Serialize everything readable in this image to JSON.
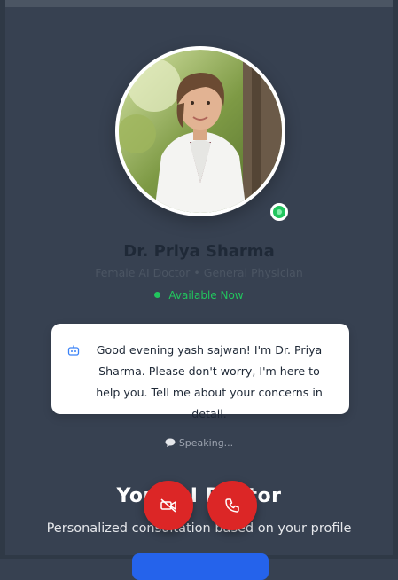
{
  "doctor": {
    "name": "Dr. Priya Sharma",
    "subtitle": "Female AI Doctor • General Physician",
    "status": "Available Now"
  },
  "message": {
    "text": "Good evening yash sajwan! I'm Dr. Priya Sharma. Please don't worry, I'm here to help you. Tell me about your concerns in detail."
  },
  "speaking_label": "Speaking...",
  "hero": {
    "title": "Your AI Doctor",
    "subtitle": "Personalized consultation based on your profile"
  },
  "colors": {
    "background": "#374151",
    "online": "#22c55e",
    "call_button": "#dc2626",
    "primary": "#2563eb"
  },
  "icons": {
    "video_off": "video-off-icon",
    "phone": "phone-icon",
    "bot": "bot-icon",
    "speech": "speech-bubble-icon"
  }
}
